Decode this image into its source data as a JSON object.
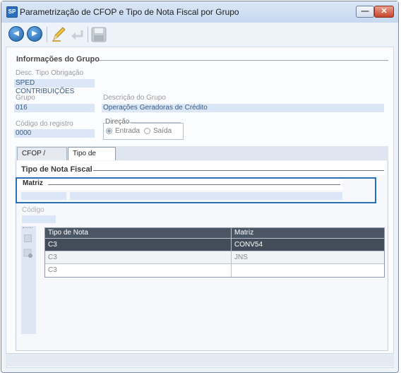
{
  "window": {
    "title": "Parametrização de CFOP e Tipo de Nota Fiscal por Grupo",
    "min_glyph": "—",
    "close_glyph": "✕"
  },
  "toolbar": {
    "back_glyph": "◀",
    "forward_glyph": "▶"
  },
  "group_info": {
    "title": "Informações do Grupo",
    "desc_tipo_obrigacao_label": "Desc. Tipo Obrigação",
    "desc_tipo_obrigacao_value": "SPED CONTRIBUIÇÕES",
    "grupo_label": "Grupo",
    "grupo_value": "016",
    "descricao_label": "Descrição do Grupo",
    "descricao_value": "Operações Geradoras de Crédito",
    "codigo_registro_label": "Código do registro",
    "codigo_registro_value": "0000",
    "direcao_label": "Direção",
    "direcao_options": [
      "Entrada",
      "Saída"
    ],
    "direcao_selected": "Entrada"
  },
  "tabs": [
    {
      "label": "CFOP / Dígito",
      "active": false
    },
    {
      "label": "Tipo de Nota",
      "active": true
    }
  ],
  "tipo_nota": {
    "section_title": "Tipo de Nota Fiscal",
    "matriz_title": "Matriz",
    "codigo_label": "Código",
    "table": {
      "columns": [
        "Tipo de Nota",
        "Matriz"
      ],
      "rows": [
        {
          "tipo": "C3",
          "matriz": "CONV54",
          "selected": true
        },
        {
          "tipo": "C3",
          "matriz": "JNS",
          "selected": false
        },
        {
          "tipo": "C3",
          "matriz": "",
          "selected": false
        }
      ]
    }
  },
  "colors": {
    "accent": "#2b6fb5",
    "grid_header": "#4b5665",
    "selected_row": "#434c59",
    "field_bg": "#dbe7f6"
  }
}
